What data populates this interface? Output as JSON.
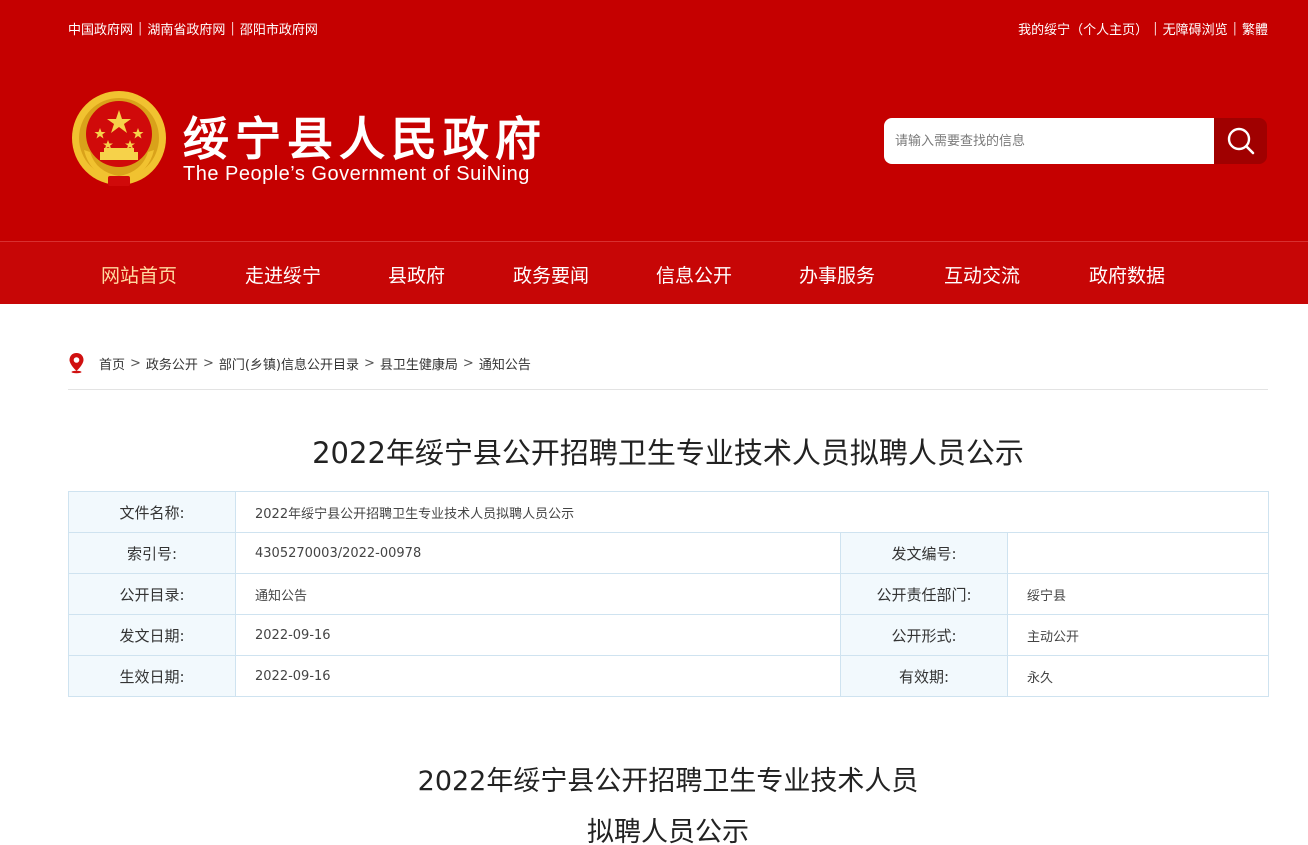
{
  "topbar": {
    "left_links": [
      "中国政府网",
      "湖南省政府网",
      "邵阳市政府网"
    ],
    "right_links": [
      "我的绥宁（个人主页）",
      "无障碍浏览",
      "繁體"
    ],
    "separator": "|"
  },
  "site": {
    "title": "绥宁县人民政府",
    "subtitle": "The People’s Government of SuiNing"
  },
  "search": {
    "placeholder": "请输入需要查找的信息",
    "icon": "search-icon"
  },
  "nav": {
    "items": [
      "网站首页",
      "走进绥宁",
      "县政府",
      "政务要闻",
      "信息公开",
      "办事服务",
      "互动交流",
      "政府数据"
    ],
    "active_index": 0
  },
  "breadcrumb": {
    "icon": "location-pin-icon",
    "items": [
      "首页",
      "政务公开",
      "部门(乡镇)信息公开目录",
      "县卫生健康局",
      "通知公告"
    ],
    "separator": ">"
  },
  "article": {
    "title": "2022年绥宁县公开招聘卫生专业技术人员拟聘人员公示",
    "meta": {
      "file_name_label": "文件名称:",
      "file_name": "2022年绥宁县公开招聘卫生专业技术人员拟聘人员公示",
      "index_label": "索引号:",
      "index": "4305270003/2022-00978",
      "doc_no_label": "发文编号:",
      "doc_no": "",
      "catalog_label": "公开目录:",
      "catalog": "通知公告",
      "dept_label": "公开责任部门:",
      "dept": "绥宁县",
      "issue_date_label": "发文日期:",
      "issue_date": "2022-09-16",
      "form_label": "公开形式:",
      "form": "主动公开",
      "effective_label": "生效日期:",
      "effective": "2022-09-16",
      "validity_label": "有效期:",
      "validity": "永久"
    },
    "body_title_line1": "2022年绥宁县公开招聘卫生专业技术人员",
    "body_title_line2": "拟聘人员公示"
  },
  "colors": {
    "brand_red": "#c50000",
    "nav_active": "#ffd9a0",
    "table_label_bg": "#f2f9fd",
    "table_border": "#cfe3f0"
  }
}
